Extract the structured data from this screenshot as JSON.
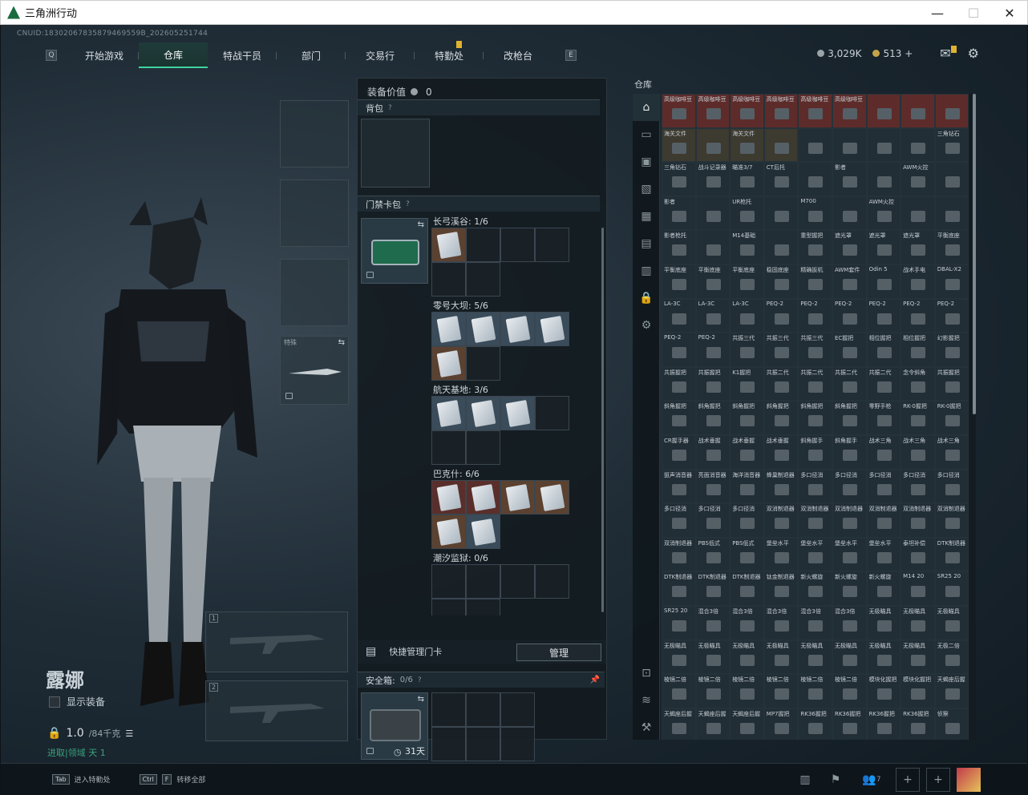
{
  "window": {
    "title": "三角洲行动",
    "minimize": "—",
    "maximize": "☐",
    "close": "✕"
  },
  "uid": "CNUID:18302067835879469559B_202605251744",
  "tabs": [
    {
      "label": "开始游戏"
    },
    {
      "label": "仓库",
      "active": true
    },
    {
      "label": "特战干员"
    },
    {
      "label": "部门"
    },
    {
      "label": "交易行"
    },
    {
      "label": "特勤处",
      "badge": true
    },
    {
      "label": "改枪台"
    }
  ],
  "currency": {
    "silver": "3,029K",
    "gold": "513",
    "plus": "+"
  },
  "character": {
    "name": "露娜",
    "show_equipment": "显示装备",
    "weight": "1.0",
    "weight_unit": "/84千克",
    "status": "进取|领域   天 1"
  },
  "slots": {
    "melee_label": "特殊",
    "weapon1_num": "1",
    "weapon2_num": "2"
  },
  "mid": {
    "equip_value_label": "装备价值",
    "equip_value": "0",
    "backpack_label": "背包",
    "keycard_label": "门禁卡包",
    "groups": [
      {
        "name": "长弓溪谷: 1/6"
      },
      {
        "name": "零号大坝: 5/6"
      },
      {
        "name": "航天基地: 3/6"
      },
      {
        "name": "巴克什: 6/6"
      },
      {
        "name": "潮汐监狱: 0/6"
      }
    ],
    "quick_manage": "快捷管理门卡",
    "manage_button": "管理",
    "safebox_label": "安全箱:",
    "safebox_count": "0/6",
    "safebox_days": "31天"
  },
  "warehouse": {
    "title": "仓库",
    "rows": [
      [
        "高级咖啡豆",
        "高级咖啡豆",
        "高级咖啡豆",
        "高级咖啡豆",
        "高级咖啡豆",
        "高级咖啡豆",
        "",
        "",
        ""
      ],
      [
        "海关文件",
        "",
        "海关文件",
        "",
        "",
        "",
        "",
        "",
        "三角钻石"
      ],
      [
        "三角钻石",
        "战斗记录器",
        "瞄准3/7",
        "CT后托",
        "",
        "影者",
        "",
        "AWM火控",
        ""
      ],
      [
        "影者",
        "",
        "UR枪托",
        "",
        "M700",
        "",
        "AWM火控",
        "",
        ""
      ],
      [
        "影者枪托",
        "",
        "M14基础",
        "",
        "重型握把",
        "遮光罩",
        "遮光罩",
        "遮光罩",
        "平衡底座"
      ],
      [
        "平衡底座",
        "平衡底座",
        "平衡底座",
        "稳固底座",
        "精确扳机",
        "AWM套件",
        "Odin 5",
        "战术手电",
        "DBAL-X2"
      ],
      [
        "LA-3C",
        "LA-3C",
        "LA-3C",
        "PEQ-2",
        "PEQ-2",
        "PEQ-2",
        "PEQ-2",
        "PEQ-2",
        "PEQ-2"
      ],
      [
        "PEQ-2",
        "PEQ-2",
        "共振三代",
        "共振三代",
        "共振三代",
        "EC握把",
        "相位握把",
        "相位握把",
        "幻影握把"
      ],
      [
        "共振握把",
        "共振握把",
        "K1握把",
        "共振二代",
        "共振二代",
        "共振二代",
        "共振二代",
        "念令斜角",
        "共振握把"
      ],
      [
        "斜角握把",
        "斜角握把",
        "斜角握把",
        "斜角握把",
        "斜角握把",
        "斜角握把",
        "零野手枪",
        "RK-0握把",
        "RK-0握把"
      ],
      [
        "CR握手器",
        "战术垂握",
        "战术垂握",
        "战术垂握",
        "斜角握手",
        "斜角握手",
        "战术三角",
        "战术三角",
        "战术三角"
      ],
      [
        "狙声消音器",
        "亮面消音器",
        "海洋消音器",
        "蜂巢制退器",
        "多口径消",
        "多口径消",
        "多口径消",
        "多口径消",
        "多口径消"
      ],
      [
        "多口径消",
        "多口径消",
        "多口径消",
        "双消制退器",
        "双消制退器",
        "双消制退器",
        "双消制退器",
        "双消制退器",
        "双消制退器"
      ],
      [
        "双消制退器",
        "PBS低式",
        "PBS低式",
        "堡垒水平",
        "堡垒水平",
        "堡垒水平",
        "堡垒水平",
        "泰坦补偿",
        "DTK制退器"
      ],
      [
        "DTK制退器",
        "DTK制退器",
        "DTK制退器",
        "钛金制退器",
        "新火螺旋",
        "新火螺旋",
        "新火螺旋",
        "M14 20",
        "SR25 20"
      ],
      [
        "SR25 20",
        "混合3倍",
        "混合3倍",
        "混合3倍",
        "混合3倍",
        "混合3倍",
        "无极瞄具",
        "无极瞄具",
        "无极瞄具"
      ],
      [
        "无极瞄具",
        "无极瞄具",
        "无极瞄具",
        "无极瞄具",
        "无极瞄具",
        "无极瞄具",
        "无极瞄具",
        "无极瞄具",
        "无极二倍"
      ],
      [
        "棱镜二倍",
        "棱镜二倍",
        "棱镜二倍",
        "棱镜二倍",
        "棱镜二倍",
        "棱镜二倍",
        "模块化握把",
        "模块化握把",
        "天蝎座后握"
      ],
      [
        "天蝎座后握",
        "天蝎座后握",
        "天蝎座后握",
        "MP7握把",
        "RK36握把",
        "RK36握把",
        "RK36握把",
        "RK36握把",
        "侦察"
      ]
    ]
  },
  "bottom": {
    "tab_key": "Tab",
    "tab_action": "进入特勤处",
    "ctrl_key": "Ctrl",
    "f_key": "F",
    "ctrl_action": "转移全部",
    "friends": "7"
  }
}
